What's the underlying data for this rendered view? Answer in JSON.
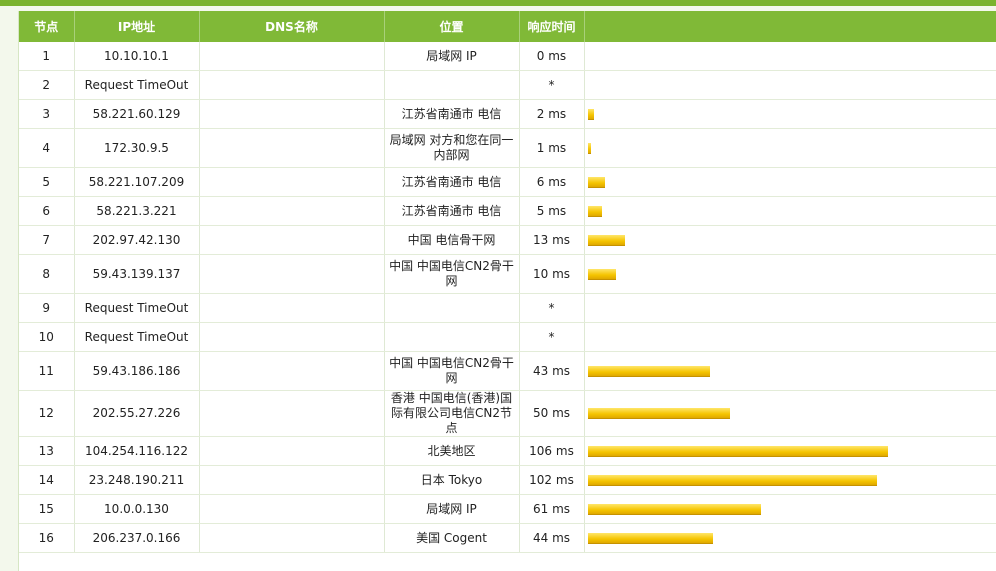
{
  "headers": [
    "节点",
    "IP地址",
    "DNS名称",
    "位置",
    "响应时间",
    ""
  ],
  "max_ms": 120,
  "rows": [
    {
      "hop": "1",
      "ip": "10.10.10.1",
      "dns": "",
      "loc": "局域网 IP",
      "time": "0 ms",
      "ms": 0
    },
    {
      "hop": "2",
      "ip": "Request TimeOut",
      "dns": "",
      "loc": "",
      "time": "*",
      "ms": null
    },
    {
      "hop": "3",
      "ip": "58.221.60.129",
      "dns": "",
      "loc": "江苏省南通市 电信",
      "time": "2 ms",
      "ms": 2
    },
    {
      "hop": "4",
      "ip": "172.30.9.5",
      "dns": "",
      "loc": "局域网 对方和您在同一内部网",
      "time": "1 ms",
      "ms": 1
    },
    {
      "hop": "5",
      "ip": "58.221.107.209",
      "dns": "",
      "loc": "江苏省南通市 电信",
      "time": "6 ms",
      "ms": 6
    },
    {
      "hop": "6",
      "ip": "58.221.3.221",
      "dns": "",
      "loc": "江苏省南通市 电信",
      "time": "5 ms",
      "ms": 5
    },
    {
      "hop": "7",
      "ip": "202.97.42.130",
      "dns": "",
      "loc": "中国 电信骨干网",
      "time": "13 ms",
      "ms": 13
    },
    {
      "hop": "8",
      "ip": "59.43.139.137",
      "dns": "",
      "loc": "中国 中国电信CN2骨干网",
      "time": "10 ms",
      "ms": 10
    },
    {
      "hop": "9",
      "ip": "Request TimeOut",
      "dns": "",
      "loc": "",
      "time": "*",
      "ms": null
    },
    {
      "hop": "10",
      "ip": "Request TimeOut",
      "dns": "",
      "loc": "",
      "time": "*",
      "ms": null
    },
    {
      "hop": "11",
      "ip": "59.43.186.186",
      "dns": "",
      "loc": "中国 中国电信CN2骨干网",
      "time": "43 ms",
      "ms": 43
    },
    {
      "hop": "12",
      "ip": "202.55.27.226",
      "dns": "",
      "loc": "香港 中国电信(香港)国际有限公司电信CN2节点",
      "time": "50 ms",
      "ms": 50
    },
    {
      "hop": "13",
      "ip": "104.254.116.122",
      "dns": "",
      "loc": "北美地区",
      "time": "106 ms",
      "ms": 106
    },
    {
      "hop": "14",
      "ip": "23.248.190.211",
      "dns": "",
      "loc": "日本 Tokyo",
      "time": "102 ms",
      "ms": 102
    },
    {
      "hop": "15",
      "ip": "10.0.0.130",
      "dns": "",
      "loc": "局域网 IP",
      "time": "61 ms",
      "ms": 61
    },
    {
      "hop": "16",
      "ip": "206.237.0.166",
      "dns": "",
      "loc": "美国 Cogent",
      "time": "44 ms",
      "ms": 44
    }
  ],
  "colors": {
    "header": "#80b937",
    "bar": "#f5c400"
  }
}
